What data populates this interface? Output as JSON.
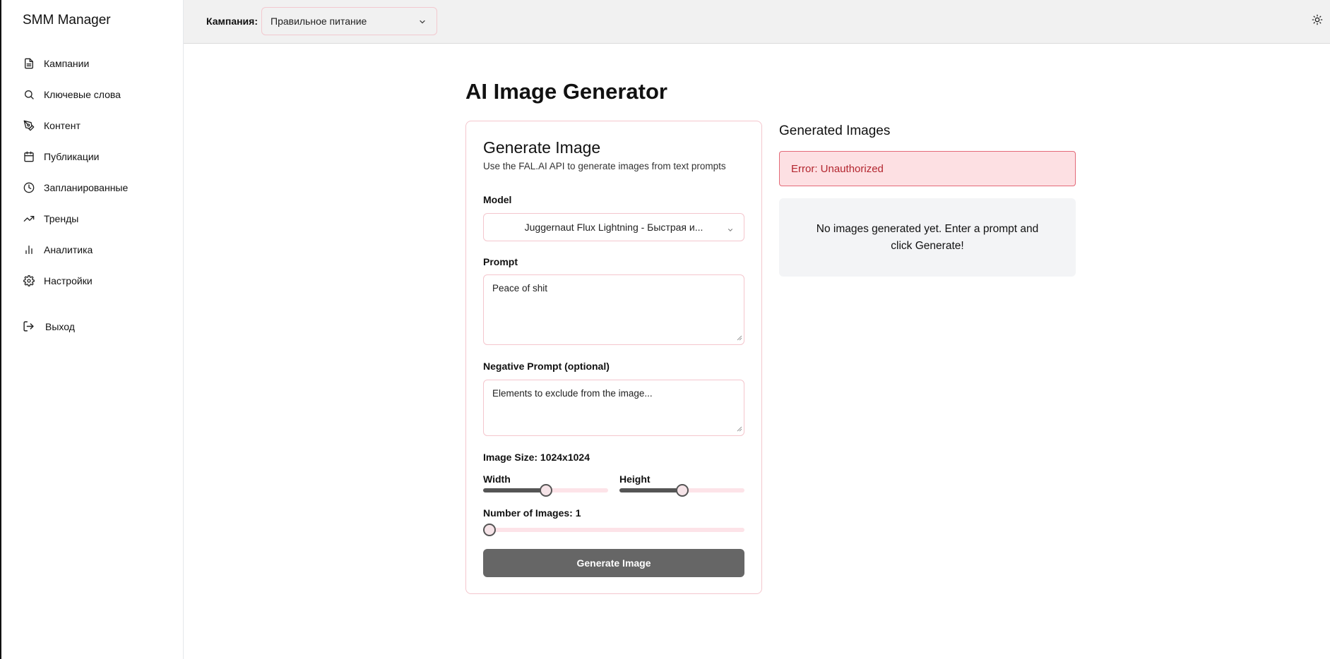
{
  "app": {
    "brand": "SMM Manager"
  },
  "sidebar": {
    "items": [
      {
        "label": "Кампании",
        "icon": "document-icon"
      },
      {
        "label": "Ключевые слова",
        "icon": "search-icon"
      },
      {
        "label": "Контент",
        "icon": "pen-icon"
      },
      {
        "label": "Публикации",
        "icon": "calendar-icon"
      },
      {
        "label": "Запланированные",
        "icon": "clock-icon"
      },
      {
        "label": "Тренды",
        "icon": "trending-icon"
      },
      {
        "label": "Аналитика",
        "icon": "bar-chart-icon"
      },
      {
        "label": "Настройки",
        "icon": "gear-icon"
      }
    ],
    "logout": {
      "label": "Выход",
      "icon": "logout-icon"
    }
  },
  "topbar": {
    "campaign_label": "Кампания:",
    "campaign_value": "Правильное питание",
    "theme_icon": "sun-icon"
  },
  "page": {
    "title": "AI Image Generator"
  },
  "form": {
    "title": "Generate Image",
    "description": "Use the FAL.AI API to generate images from text prompts",
    "model_label": "Model",
    "model_value": "Juggernaut Flux Lightning - Быстрая и...",
    "prompt_label": "Prompt",
    "prompt_value": "Peace of shit",
    "negative_label": "Negative Prompt (optional)",
    "negative_placeholder": "Elements to exclude from the image...",
    "image_size_label": "Image Size: 1024x1024",
    "width_label": "Width",
    "width_fraction": 0.5,
    "height_label": "Height",
    "height_fraction": 0.5,
    "num_images_label": "Number of Images: 1",
    "num_images_fraction": 0.0,
    "generate_label": "Generate Image"
  },
  "results": {
    "title": "Generated Images",
    "error": "Error: Unauthorized",
    "empty": "No images generated yet. Enter a prompt and click Generate!"
  },
  "colors": {
    "accent_border": "#f4c6cd",
    "error_bg": "#fde0e3",
    "error_text": "#b3262f",
    "button_bg": "#666666"
  }
}
